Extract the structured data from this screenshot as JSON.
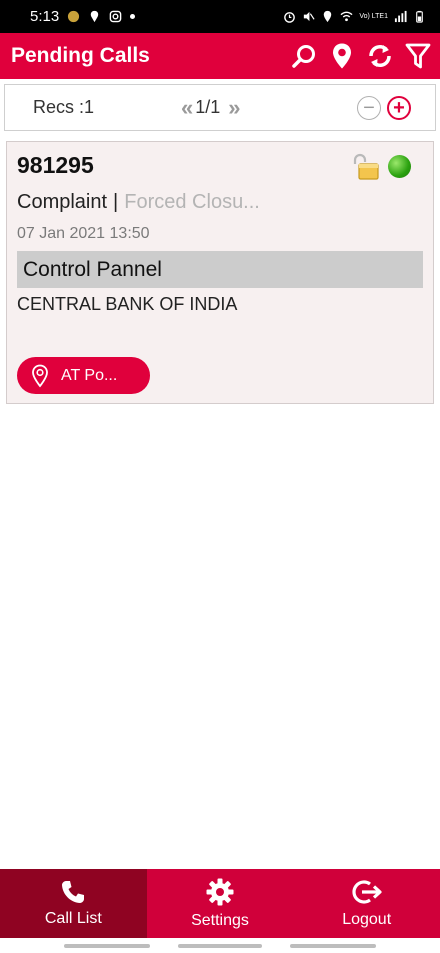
{
  "status_bar": {
    "time": "5:13",
    "network_label": "Vo) LTE1"
  },
  "app_bar": {
    "title": "Pending Calls",
    "actions": [
      "search-icon",
      "location-pin-icon",
      "refresh-icon",
      "filter-icon"
    ]
  },
  "recs_bar": {
    "count_label": "Recs :1",
    "page_label": "1/1",
    "prev_glyph": "«",
    "next_glyph": "»",
    "minus_glyph": "−",
    "plus_glyph": "+"
  },
  "call_card": {
    "call_id": "981295",
    "call_type": "Complaint",
    "separator": "|",
    "status_text": "Forced Closu...",
    "datetime": "07 Jan 2021 13:50",
    "product": "Control Pannel",
    "customer": "CENTRAL BANK OF INDIA",
    "location_button": "AT Po...",
    "status_color": "#2aa10f"
  },
  "bottom_nav": {
    "items": [
      {
        "label": "Call List",
        "icon": "phone-icon",
        "active": true
      },
      {
        "label": "Settings",
        "icon": "gear-icon",
        "active": false
      },
      {
        "label": "Logout",
        "icon": "logout-icon",
        "active": false
      }
    ]
  },
  "colors": {
    "primary": "#e0003c",
    "nav_active": "#8f0322",
    "card_bg": "#f7f0f0"
  }
}
